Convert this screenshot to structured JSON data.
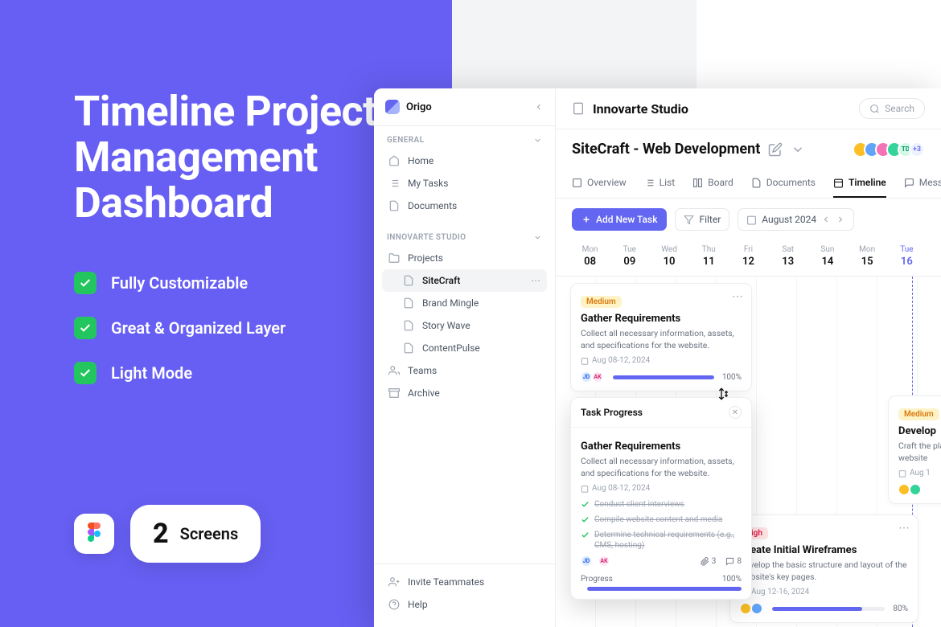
{
  "promo": {
    "headline_l1": "Timeline Project",
    "headline_l2": "Management",
    "headline_l3": "Dashboard",
    "features": [
      "Fully Customizable",
      "Great & Organized Layer",
      "Light Mode"
    ],
    "screens_count": "2",
    "screens_label": "Screens"
  },
  "sidebar": {
    "app_name": "Origo",
    "sections": {
      "general_label": "GENERAL",
      "workspace_label": "INNOVARTE STUDIO"
    },
    "general": [
      "Home",
      "My Tasks",
      "Documents"
    ],
    "projects_root": "Projects",
    "projects": [
      "SiteCraft",
      "Brand Mingle",
      "Story Wave",
      "ContentPulse"
    ],
    "teams": "Teams",
    "archive": "Archive",
    "invite": "Invite Teammates",
    "help": "Help"
  },
  "topbar": {
    "workspace": "Innovarte Studio",
    "search_placeholder": "Search"
  },
  "project": {
    "title": "SiteCraft - Web Development",
    "avatar_td": "TD",
    "avatar_more": "+3"
  },
  "tabs": [
    "Overview",
    "List",
    "Board",
    "Documents",
    "Timeline",
    "Messages"
  ],
  "toolbar": {
    "add_task": "Add New Task",
    "filter": "Filter",
    "month": "August 2024"
  },
  "days": [
    {
      "dow": "Mon",
      "num": "08"
    },
    {
      "dow": "Tue",
      "num": "09"
    },
    {
      "dow": "Wed",
      "num": "10"
    },
    {
      "dow": "Thu",
      "num": "11"
    },
    {
      "dow": "Fri",
      "num": "12"
    },
    {
      "dow": "Sat",
      "num": "13"
    },
    {
      "dow": "Sun",
      "num": "14"
    },
    {
      "dow": "Mon",
      "num": "15"
    },
    {
      "dow": "Tue",
      "num": "16"
    }
  ],
  "cards": {
    "c1": {
      "priority": "Medium",
      "title": "Gather Requirements",
      "desc": "Collect all necessary information, assets, and specifications for the website.",
      "date": "Aug 08-12, 2024",
      "pct": "100%",
      "fill": "100%"
    },
    "c3": {
      "priority": "Medium",
      "title": "Develop",
      "desc": "Craft the plan that will define the website",
      "date": "Aug 1"
    },
    "c4": {
      "priority": "High",
      "title": "Create Initial Wireframes",
      "desc": "Develop the basic structure and layout of the website's key pages.",
      "date": "Aug 12-16, 2024",
      "pct": "80%",
      "fill": "80%"
    }
  },
  "popup": {
    "header": "Task Progress",
    "title": "Gather Requirements",
    "desc": "Collect all necessary information, assets, and specifications for the website.",
    "date": "Aug 08-12, 2024",
    "subtasks": [
      "Conduct client interviews",
      "Compile website content and media",
      "Determine technical requirements (e.g., CMS, hosting)"
    ],
    "attachments": "3",
    "comments": "8",
    "progress_label": "Progress",
    "progress_pct": "100%"
  }
}
